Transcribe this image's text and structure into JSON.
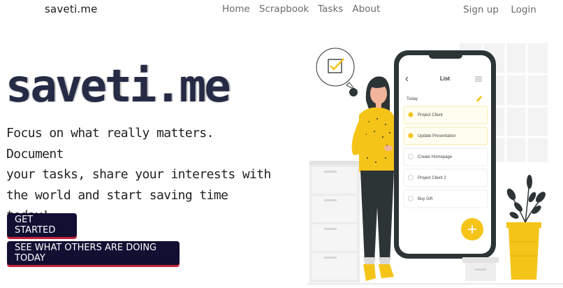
{
  "nav": {
    "brand": "saveti.me",
    "links": [
      "Home",
      "Scrapbook",
      "Tasks",
      "About"
    ],
    "signup": "Sign up",
    "login": "Login"
  },
  "hero": {
    "title": "saveti.me",
    "text_lines": [
      "Focus on what really matters. Document",
      "your tasks, share your interests with",
      "the world and start saving time today!"
    ],
    "cta_primary": "GET STARTED",
    "cta_secondary": "SEE WHAT OTHERS ARE DOING TODAY"
  },
  "illustration": {
    "phone": {
      "header": "List",
      "section": "Today",
      "tasks": [
        {
          "label": "Project Client",
          "done": true
        },
        {
          "label": "Update Presentation",
          "done": true
        },
        {
          "label": "Create Homepage",
          "done": false
        },
        {
          "label": "Project Client 2",
          "done": false
        },
        {
          "label": "Buy Gift",
          "done": false
        }
      ]
    },
    "icons": [
      "back-arrow-icon",
      "menu-icon",
      "pencil-icon",
      "plus-icon",
      "checkbox-icon"
    ],
    "colors": {
      "accent_yellow": "#f5c418",
      "phone_frame": "#2d3436",
      "dark_navy": "#120f33",
      "button_shadow": "#c5243a"
    }
  }
}
